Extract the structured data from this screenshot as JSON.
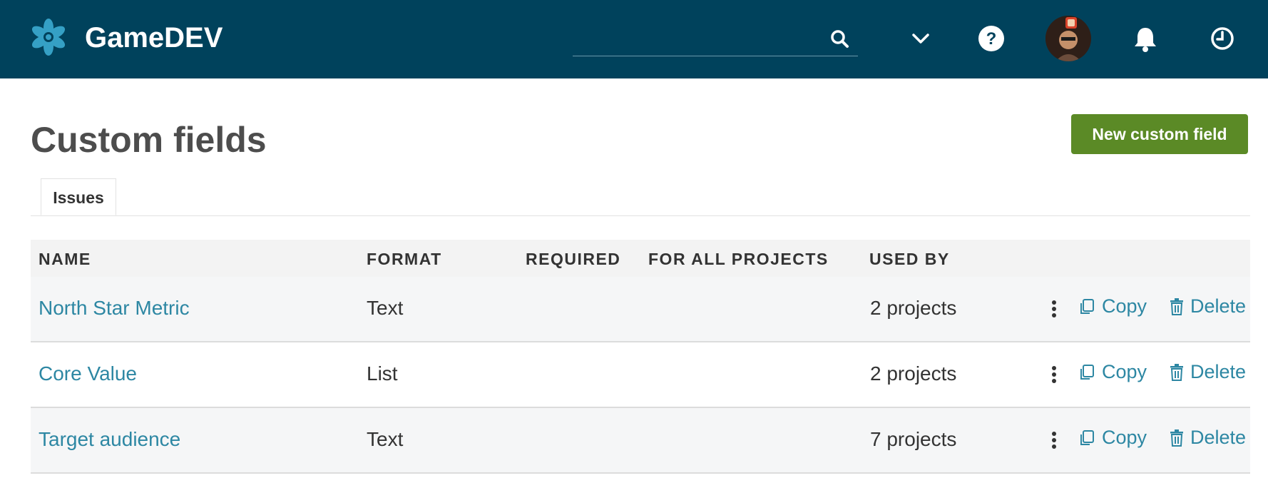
{
  "header": {
    "app_title": "GameDEV",
    "search_value": "",
    "icons": {
      "logo": "asterisk-logo-icon",
      "search": "search-icon",
      "menu": "chevron-down-icon",
      "help": "help-icon",
      "avatar": "user-avatar",
      "notifications": "bell-icon",
      "time": "clock-icon"
    },
    "colors": {
      "background": "#00425c",
      "text": "#ffffff",
      "logo": "#35a0c5"
    }
  },
  "page": {
    "title": "Custom fields",
    "new_button_label": "New custom field",
    "new_button_color": "#5b8a26",
    "tabs": [
      {
        "label": "Issues",
        "active": true
      }
    ]
  },
  "table": {
    "headers": [
      "NAME",
      "FORMAT",
      "REQUIRED",
      "FOR ALL PROJECTS",
      "USED BY"
    ],
    "rows": [
      {
        "name": "North Star Metric",
        "format": "Text",
        "required": "",
        "for_all_projects": "",
        "used_by": "2 projects",
        "copy_label": "Copy",
        "delete_label": "Delete"
      },
      {
        "name": "Core Value",
        "format": "List",
        "required": "",
        "for_all_projects": "",
        "used_by": "2 projects",
        "copy_label": "Copy",
        "delete_label": "Delete"
      },
      {
        "name": "Target audience",
        "format": "Text",
        "required": "",
        "for_all_projects": "",
        "used_by": "7 projects",
        "copy_label": "Copy",
        "delete_label": "Delete"
      }
    ],
    "link_color": "#2d87a3"
  }
}
